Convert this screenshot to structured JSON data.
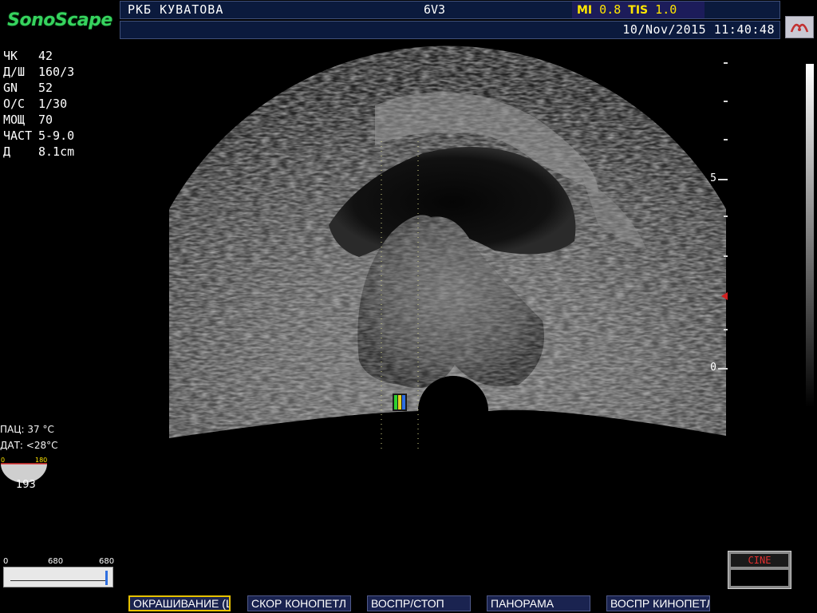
{
  "header": {
    "logo": "SonoScape",
    "patient": "РКБ КУВАТОВА",
    "probe": "6V3",
    "mi_label": "MI",
    "mi_value": "0.8",
    "tis_label": "TIS",
    "tis_value": "1.0",
    "datetime": "10/Nov/2015  11:40:48"
  },
  "params": [
    {
      "key": "ЧК",
      "value": "42"
    },
    {
      "key": "Д/Ш",
      "value": "160/3"
    },
    {
      "key": "GN",
      "value": "52"
    },
    {
      "key": "О/С",
      "value": "1/30"
    },
    {
      "key": "МОЩ",
      "value": "70"
    },
    {
      "key": "ЧАСТ",
      "value": "5-9.0"
    },
    {
      "key": "Д",
      "value": "8.1cm"
    }
  ],
  "depth_scale": {
    "labels": [
      "5",
      "0"
    ]
  },
  "temps": {
    "pat_label": "ПАЦ:",
    "pat_value": "37 °C",
    "probe_label": "ДАТ:",
    "probe_value": "<28°C"
  },
  "angle": {
    "min": "0",
    "max": "180",
    "value": "193"
  },
  "cine_scale": {
    "start": "0",
    "mid": "680",
    "end": "680"
  },
  "cine_indicator": "CINE",
  "softkeys": [
    {
      "label": "ОКРАШИВАНИЕ (ЦВ",
      "active": true
    },
    {
      "label": "СКОР КОНОПЕТЛ",
      "active": false
    },
    {
      "label": "ВОСПР/СТОП",
      "active": false
    },
    {
      "label": "ПАНОРАМА",
      "active": false
    },
    {
      "label": "ВОСПР КИНОПЕТЛ",
      "active": false
    }
  ],
  "colors": {
    "logo": "#36d35e",
    "index_text": "#ffe600",
    "header_bg": "#0b1a3d",
    "cine_text": "#e03030",
    "active_softkey_border": "#e6c100"
  }
}
